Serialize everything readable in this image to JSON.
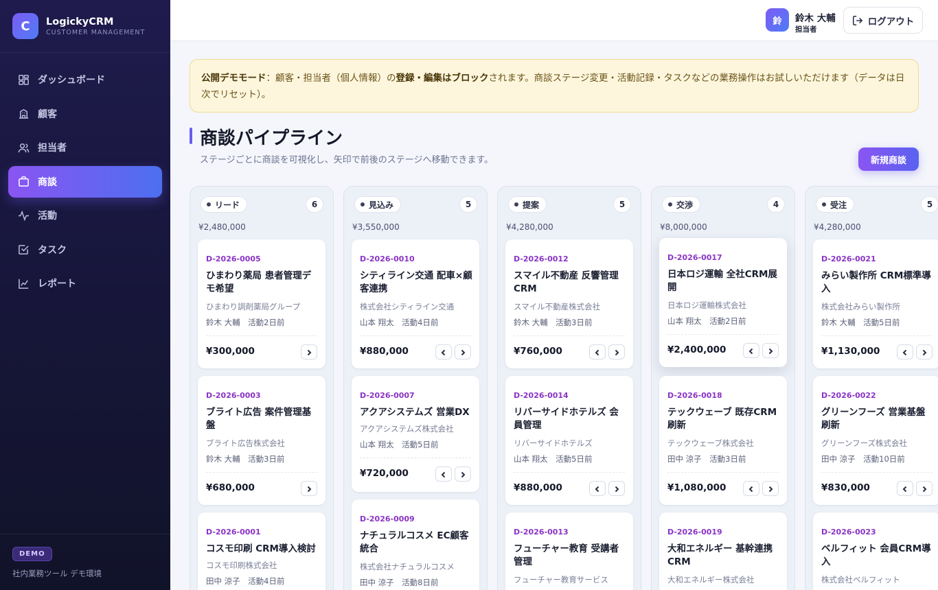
{
  "brand": {
    "logo": "C",
    "name": "LogickyCRM",
    "subtitle": "CUSTOMER MANAGEMENT"
  },
  "sidebar": {
    "items": [
      {
        "label": "ダッシュボード",
        "icon": "dashboard-icon"
      },
      {
        "label": "顧客",
        "icon": "building-icon"
      },
      {
        "label": "担当者",
        "icon": "users-icon"
      },
      {
        "label": "商談",
        "icon": "briefcase-icon",
        "active": true
      },
      {
        "label": "活動",
        "icon": "activity-icon"
      },
      {
        "label": "タスク",
        "icon": "checkbox-icon"
      },
      {
        "label": "レポート",
        "icon": "chart-icon"
      }
    ],
    "footer_badge": "DEMO",
    "footer_note": "社内業務ツール デモ環境"
  },
  "topbar": {
    "avatar": "鈴",
    "user_name": "鈴木 大輔",
    "user_role": "担当者",
    "logout_label": "ログアウト"
  },
  "notice": {
    "bold1": "公開デモモード",
    "text1": "：顧客・担当者（個人情報）の",
    "bold2": "登録・編集はブロック",
    "text2": "されます。商談ステージ変更・活動記録・タスクなどの業務操作はお試しいただけます（データは日次でリセット）。"
  },
  "header": {
    "title": "商談パイプライン",
    "subtitle": "ステージごとに商談を可視化し、矢印で前後のステージへ移動できます。",
    "new_button": "新規商談"
  },
  "columns": [
    {
      "name": "リード",
      "count": "6",
      "total": "¥2,480,000",
      "cards": [
        {
          "id": "D-2026-0005",
          "title": "ひまわり薬局 患者管理デモ希望",
          "company": "ひまわり調剤薬局グループ",
          "meta": "鈴木 大輔　活動2日前",
          "amount": "¥300,000"
        },
        {
          "id": "D-2026-0003",
          "title": "ブライト広告 案件管理基盤",
          "company": "ブライト広告株式会社",
          "meta": "鈴木 大輔　活動3日前",
          "amount": "¥680,000"
        },
        {
          "id": "D-2026-0001",
          "title": "コスモ印刷 CRM導入検討",
          "company": "コスモ印刷株式会社",
          "meta": "田中 涼子　活動4日前",
          "amount": ""
        }
      ]
    },
    {
      "name": "見込み",
      "count": "5",
      "total": "¥3,550,000",
      "cards": [
        {
          "id": "D-2026-0010",
          "title": "シティライン交通 配車×顧客連携",
          "company": "株式会社シティライン交通",
          "meta": "山本 翔太　活動4日前",
          "amount": "¥880,000"
        },
        {
          "id": "D-2026-0007",
          "title": "アクアシステムズ 営業DX",
          "company": "アクアシステムズ株式会社",
          "meta": "山本 翔太　活動5日前",
          "amount": "¥720,000"
        },
        {
          "id": "D-2026-0009",
          "title": "ナチュラルコスメ EC顧客統合",
          "company": "株式会社ナチュラルコスメ",
          "meta": "田中 涼子　活動8日前",
          "amount": ""
        }
      ]
    },
    {
      "name": "提案",
      "count": "5",
      "total": "¥4,280,000",
      "cards": [
        {
          "id": "D-2026-0012",
          "title": "スマイル不動産 反響管理CRM",
          "company": "スマイル不動産株式会社",
          "meta": "鈴木 大輔　活動3日前",
          "amount": "¥760,000"
        },
        {
          "id": "D-2026-0014",
          "title": "リバーサイドホテルズ 会員管理",
          "company": "リバーサイドホテルズ",
          "meta": "山本 翔太　活動5日前",
          "amount": "¥880,000"
        },
        {
          "id": "D-2026-0013",
          "title": "フューチャー教育 受講者管理",
          "company": "フューチャー教育サービス",
          "meta": "",
          "amount": ""
        }
      ]
    },
    {
      "name": "交渉",
      "count": "4",
      "total": "¥8,000,000",
      "cards": [
        {
          "id": "D-2026-0017",
          "title": "日本ロジ運輸 全社CRM展開",
          "company": "日本ロジ運輸株式会社",
          "meta": "山本 翔太　活動2日前",
          "amount": "¥2,400,000"
        },
        {
          "id": "D-2026-0018",
          "title": "テックウェーブ 既存CRM刷新",
          "company": "テックウェーブ株式会社",
          "meta": "田中 涼子　活動3日前",
          "amount": "¥1,080,000"
        },
        {
          "id": "D-2026-0019",
          "title": "大和エネルギー 基幹連携CRM",
          "company": "大和エネルギー株式会社",
          "meta": "",
          "amount": ""
        }
      ]
    },
    {
      "name": "受注",
      "count": "5",
      "total": "¥4,280,000",
      "cards": [
        {
          "id": "D-2026-0021",
          "title": "みらい製作所 CRM標準導入",
          "company": "株式会社みらい製作所",
          "meta": "鈴木 大輔　活動5日前",
          "amount": "¥1,130,000"
        },
        {
          "id": "D-2026-0022",
          "title": "グリーンフーズ 営業基盤刷新",
          "company": "グリーンフーズ株式会社",
          "meta": "田中 涼子　活動10日前",
          "amount": "¥830,000"
        },
        {
          "id": "D-2026-0023",
          "title": "ベルフィット 会員CRM導入",
          "company": "株式会社ベルフィット",
          "meta": "",
          "amount": ""
        }
      ]
    }
  ]
}
